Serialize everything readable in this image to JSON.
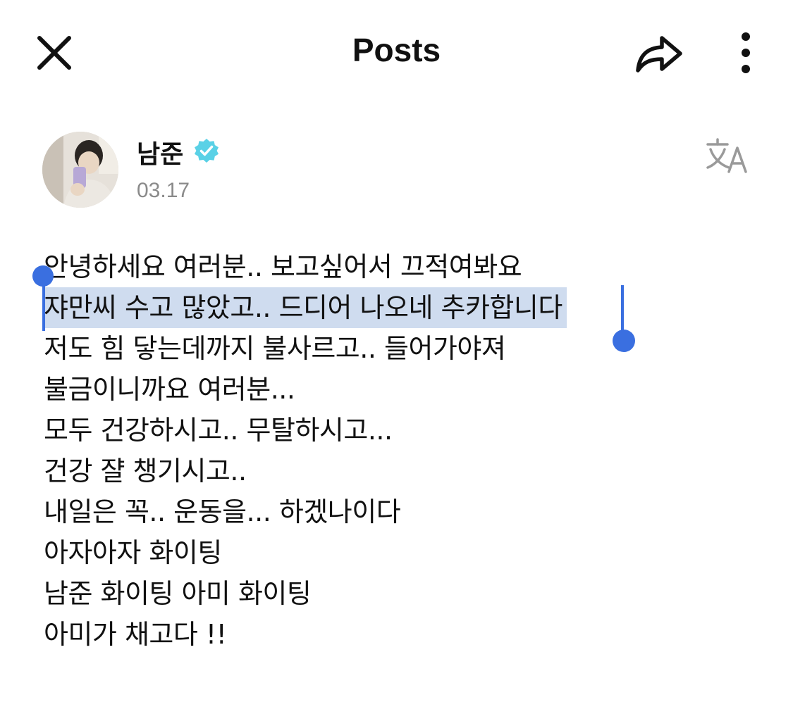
{
  "header": {
    "title": "Posts",
    "close_icon": "close-icon",
    "share_icon": "share-icon",
    "more_icon": "more-vertical-icon"
  },
  "author": {
    "name": "남준",
    "verified": true,
    "date": "03.17",
    "verified_color": "#5ad1e6"
  },
  "translate_icon": "translate-icon",
  "post": {
    "lines": [
      "안녕하세요 여러분.. 보고싶어서 끄적여봐요",
      "쟈만씨 수고 많았고.. 드디어 나오네 추카합니다",
      "저도 힘 닿는데까지 불사르고.. 들어가야져",
      "불금이니까요 여러분...",
      "모두 건강하시고.. 무탈하시고...",
      "건강 쟐 챙기시고..",
      "내일은 꼭.. 운동을... 하겠나이다",
      "아자아자 화이팅",
      "남준 화이팅 아미 화이팅",
      "아미가 채고다 !!"
    ],
    "selected_line_index": 1,
    "selection_color": "#cfdcef",
    "handle_color": "#3a6fe0"
  }
}
